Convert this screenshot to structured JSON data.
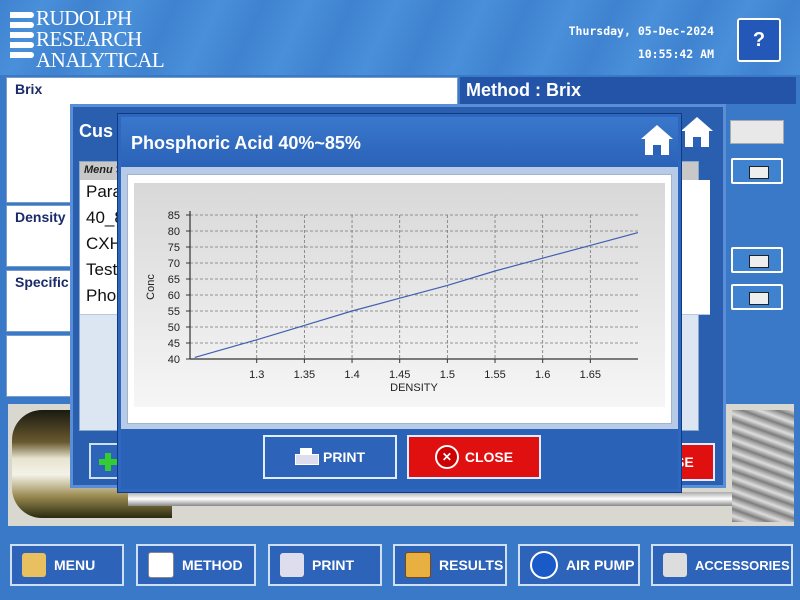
{
  "header": {
    "logo_lines": [
      "RUDOLPH",
      "RESEARCH",
      "ANALYTICAL"
    ],
    "date": "Thursday, 05-Dec-2024",
    "time": "10:55:42 AM",
    "help_label": "?"
  },
  "background": {
    "left_labels": [
      "Brix",
      "Density",
      "Specific"
    ],
    "method_label": "Method : Brix"
  },
  "behind_dialog": {
    "title": "Cus",
    "list_header": "Menu >",
    "rows": [
      "Para",
      "40_8",
      "CXH",
      "Test",
      "Phos"
    ],
    "partial_button": "SE"
  },
  "dialog": {
    "title": "Phosphoric Acid 40%~85%",
    "print_label": "PRINT",
    "close_label": "CLOSE"
  },
  "chart_data": {
    "type": "line",
    "xlabel": "DENSITY",
    "ylabel": "Conc",
    "xlim": [
      1.23,
      1.7
    ],
    "ylim": [
      40,
      85
    ],
    "x_ticks": [
      "1.3",
      "1.35",
      "1.4",
      "1.45",
      "1.5",
      "1.55",
      "1.6",
      "1.65"
    ],
    "y_ticks": [
      "40",
      "45",
      "50",
      "55",
      "60",
      "65",
      "70",
      "75",
      "80",
      "85"
    ],
    "grid": true,
    "line_color": "#4060b0",
    "series": [
      {
        "x": [
          1.235,
          1.3,
          1.35,
          1.4,
          1.45,
          1.5,
          1.55,
          1.6,
          1.65,
          1.7
        ],
        "y": [
          40.5,
          46,
          50.5,
          55,
          59,
          63,
          67.5,
          71.5,
          75.5,
          79.5
        ]
      }
    ]
  },
  "nav": [
    {
      "label": "MENU",
      "icon": "menu-icon"
    },
    {
      "label": "METHOD",
      "icon": "method-icon"
    },
    {
      "label": "PRINT",
      "icon": "printer-icon"
    },
    {
      "label": "RESULTS",
      "icon": "results-icon"
    },
    {
      "label": "AIR PUMP",
      "icon": "air-pump-icon"
    },
    {
      "label": "ACCESSORIES",
      "icon": "accessories-icon"
    }
  ]
}
